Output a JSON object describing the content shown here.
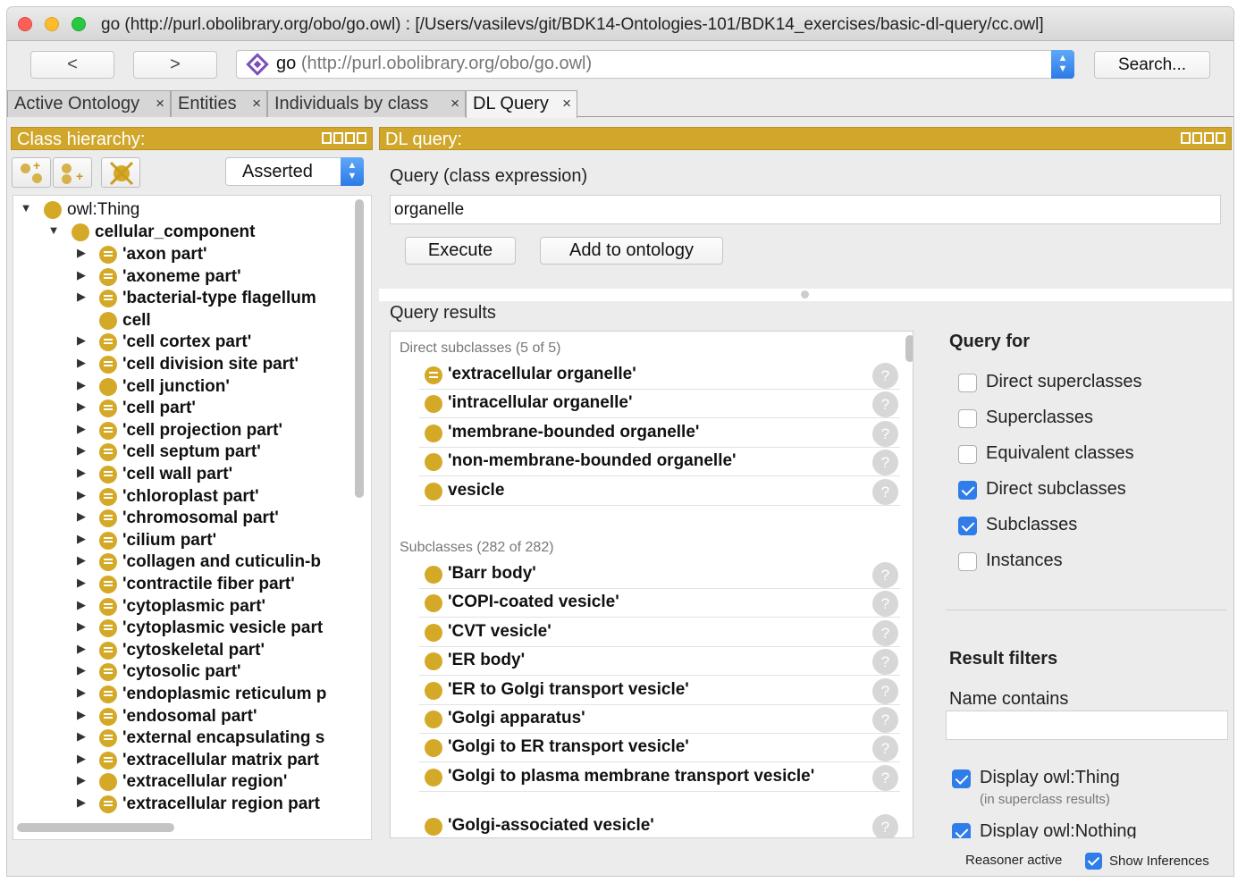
{
  "window": {
    "title": "go (http://purl.obolibrary.org/obo/go.owl)  : [/Users/vasilevs/git/BDK14-Ontologies-101/BDK14_exercises/basic-dl-query/cc.owl]"
  },
  "nav": {
    "back_label": "<",
    "forward_label": ">",
    "ontology_name": "go",
    "ontology_iri": "(http://purl.obolibrary.org/obo/go.owl)",
    "search_label": "Search..."
  },
  "tabs": [
    {
      "label": "Active Ontology"
    },
    {
      "label": "Entities"
    },
    {
      "label": "Individuals by class"
    },
    {
      "label": "DL Query",
      "active": true
    }
  ],
  "class_hierarchy": {
    "header": "Class hierarchy:",
    "mode": "Asserted",
    "root": "owl:Thing",
    "child": "cellular_component",
    "items": [
      {
        "label": "'axon part'",
        "defined": true,
        "expandable": true
      },
      {
        "label": "'axoneme part'",
        "defined": true,
        "expandable": true
      },
      {
        "label": "'bacterial-type flagellum",
        "defined": true,
        "expandable": true
      },
      {
        "label": "cell",
        "defined": false,
        "expandable": false
      },
      {
        "label": "'cell cortex part'",
        "defined": true,
        "expandable": true
      },
      {
        "label": "'cell division site part'",
        "defined": true,
        "expandable": true
      },
      {
        "label": "'cell junction'",
        "defined": false,
        "expandable": true
      },
      {
        "label": "'cell part'",
        "defined": true,
        "expandable": true
      },
      {
        "label": "'cell projection part'",
        "defined": true,
        "expandable": true
      },
      {
        "label": "'cell septum part'",
        "defined": true,
        "expandable": true
      },
      {
        "label": "'cell wall part'",
        "defined": true,
        "expandable": true
      },
      {
        "label": "'chloroplast part'",
        "defined": true,
        "expandable": true
      },
      {
        "label": "'chromosomal part'",
        "defined": true,
        "expandable": true
      },
      {
        "label": "'cilium part'",
        "defined": true,
        "expandable": true
      },
      {
        "label": "'collagen and cuticulin-b",
        "defined": true,
        "expandable": true
      },
      {
        "label": "'contractile fiber part'",
        "defined": true,
        "expandable": true
      },
      {
        "label": "'cytoplasmic part'",
        "defined": true,
        "expandable": true
      },
      {
        "label": "'cytoplasmic vesicle part",
        "defined": true,
        "expandable": true
      },
      {
        "label": "'cytoskeletal part'",
        "defined": true,
        "expandable": true
      },
      {
        "label": "'cytosolic part'",
        "defined": true,
        "expandable": true
      },
      {
        "label": "'endoplasmic reticulum p",
        "defined": true,
        "expandable": true
      },
      {
        "label": "'endosomal part'",
        "defined": true,
        "expandable": true
      },
      {
        "label": "'external encapsulating s",
        "defined": true,
        "expandable": true
      },
      {
        "label": "'extracellular matrix part",
        "defined": true,
        "expandable": true
      },
      {
        "label": "'extracellular region'",
        "defined": false,
        "expandable": true
      },
      {
        "label": "'extracellular region part",
        "defined": true,
        "expandable": true
      }
    ]
  },
  "dl_query": {
    "header": "DL query:",
    "expression_label": "Query (class expression)",
    "expression_value": "organelle",
    "execute_label": "Execute",
    "add_label": "Add to ontology",
    "results_label": "Query results",
    "direct_title": "Direct subclasses (5 of 5)",
    "direct": [
      {
        "label": "'extracellular organelle'",
        "defined": true
      },
      {
        "label": "'intracellular organelle'",
        "defined": false
      },
      {
        "label": "'membrane-bounded organelle'",
        "defined": false
      },
      {
        "label": "'non-membrane-bounded organelle'",
        "defined": false
      },
      {
        "label": "vesicle",
        "defined": false
      }
    ],
    "sub_title": "Subclasses (282 of 282)",
    "subclasses": [
      {
        "label": "'Barr body'",
        "defined": false
      },
      {
        "label": "'COPI-coated vesicle'",
        "defined": false
      },
      {
        "label": "'CVT vesicle'",
        "defined": false
      },
      {
        "label": "'ER body'",
        "defined": false
      },
      {
        "label": "'ER to Golgi transport vesicle'",
        "defined": false
      },
      {
        "label": "'Golgi apparatus'",
        "defined": false
      },
      {
        "label": "'Golgi to ER transport vesicle'",
        "defined": false
      },
      {
        "label": "'Golgi to plasma membrane transport vesicle'",
        "defined": false
      },
      {
        "label": "'Golgi-associated vesicle'",
        "defined": false
      }
    ],
    "help_glyph": "?"
  },
  "query_for": {
    "title": "Query for",
    "options": [
      {
        "label": "Direct superclasses",
        "checked": false
      },
      {
        "label": "Superclasses",
        "checked": false
      },
      {
        "label": "Equivalent classes",
        "checked": false
      },
      {
        "label": "Direct subclasses",
        "checked": true
      },
      {
        "label": "Subclasses",
        "checked": true
      },
      {
        "label": "Instances",
        "checked": false
      }
    ]
  },
  "result_filters": {
    "title": "Result filters",
    "name_contains_label": "Name contains",
    "name_contains_value": "",
    "display_thing": "Display owl:Thing",
    "display_thing_note": "(in superclass results)",
    "display_nothing": "Display owl:Nothing"
  },
  "status": {
    "reasoner": "Reasoner active",
    "show_inferences": "Show Inferences"
  },
  "colors": {
    "accent_gold": "#d0a72a",
    "class_icon": "#d5a928",
    "checkbox_blue": "#2e7de9"
  }
}
